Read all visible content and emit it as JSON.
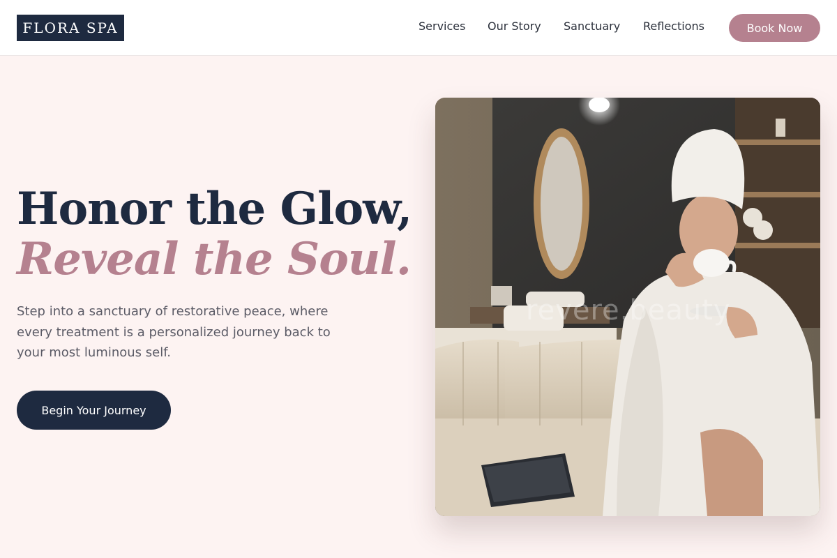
{
  "header": {
    "logo_text": "FLORA SPA",
    "nav": [
      {
        "label": "Services"
      },
      {
        "label": "Our Story"
      },
      {
        "label": "Sanctuary"
      },
      {
        "label": "Reflections"
      }
    ],
    "cta_label": "Book Now"
  },
  "hero": {
    "title_line1": "Honor the Glow,",
    "title_line2": "Reveal the Soul.",
    "subtitle": "Step into a sanctuary of restorative peace, where every treatment is a personalized journey back to your most luminous self.",
    "cta_label": "Begin Your Journey",
    "image": {
      "description": "photo",
      "watermark": "revere.beauty"
    }
  },
  "colors": {
    "navy": "#1e2a40",
    "rose": "#b5818f",
    "blush_bg": "#fdf3f2"
  }
}
